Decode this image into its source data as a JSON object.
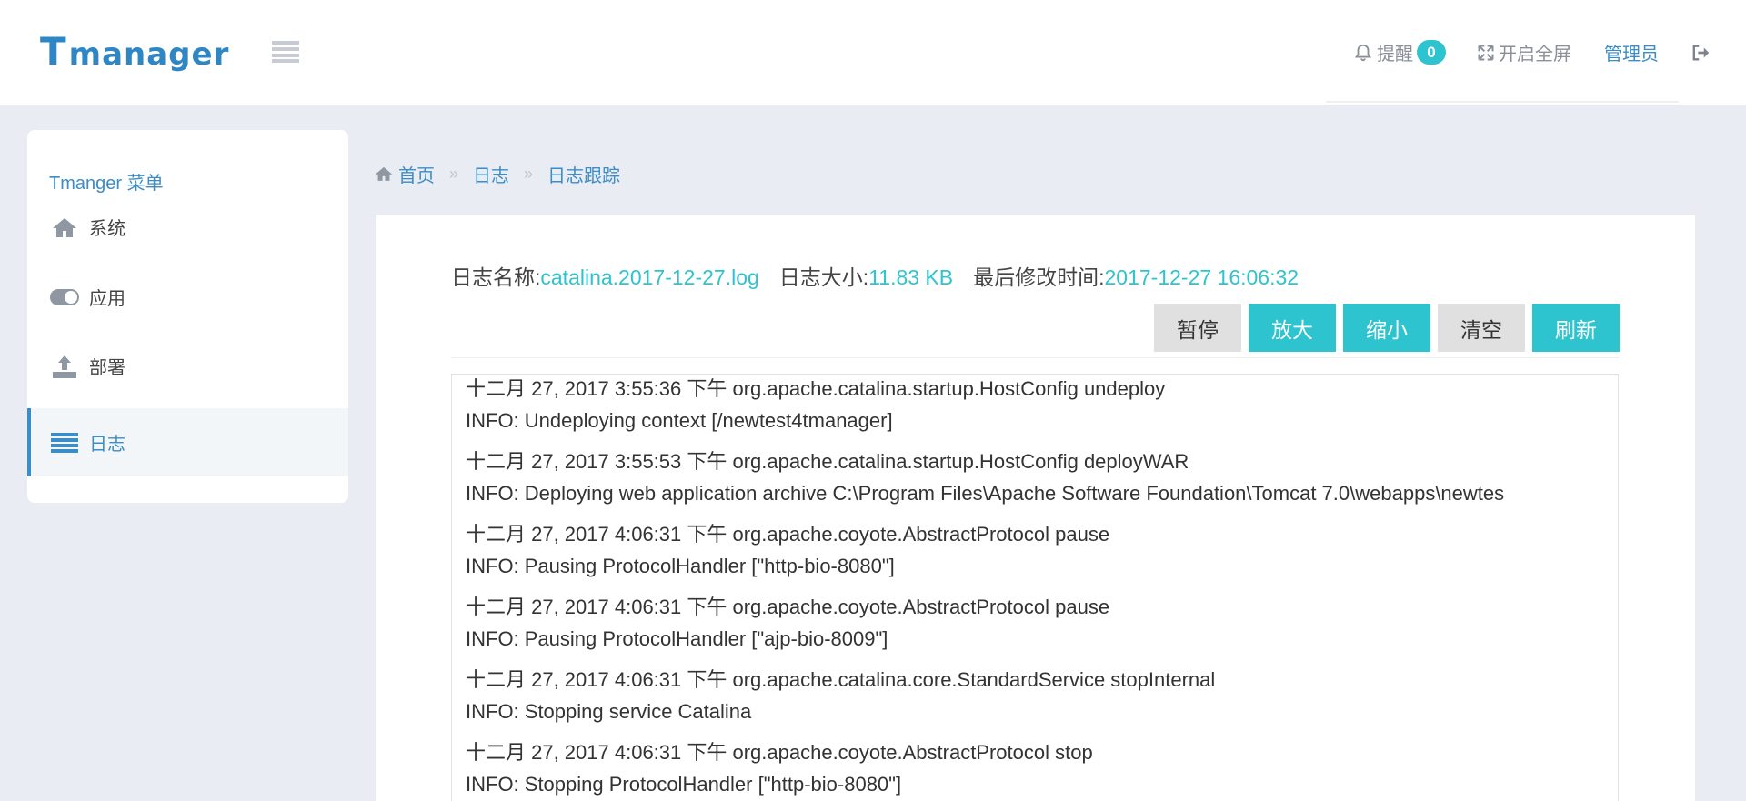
{
  "header": {
    "logo_big": "T",
    "logo_rest": "manager",
    "remind_label": "提醒",
    "remind_count": "0",
    "fullscreen_label": "开启全屏",
    "admin_label": "管理员"
  },
  "sidebar": {
    "title": "Tmanger 菜单",
    "items": [
      {
        "label": "系统",
        "icon": "home-icon"
      },
      {
        "label": "应用",
        "icon": "toggle-icon"
      },
      {
        "label": "部署",
        "icon": "upload-icon"
      },
      {
        "label": "日志",
        "icon": "list-icon"
      }
    ]
  },
  "breadcrumb": {
    "items": [
      "首页",
      "日志",
      "日志跟踪"
    ],
    "separator": "»"
  },
  "log": {
    "name_label": "日志名称:",
    "name_value": "catalina.2017-12-27.log",
    "size_label": "日志大小:",
    "size_value": "11.83 KB",
    "modified_label": "最后修改时间:",
    "modified_value": "2017-12-27 16:06:32",
    "buttons": {
      "pause": "暂停",
      "zoom_in": "放大",
      "zoom_out": "缩小",
      "clear": "清空",
      "refresh": "刷新"
    },
    "lines": [
      "十二月 27, 2017 3:55:36 下午 org.apache.catalina.startup.HostConfig undeploy",
      "INFO: Undeploying context [/newtest4tmanager]",
      "十二月 27, 2017 3:55:53 下午 org.apache.catalina.startup.HostConfig deployWAR",
      "INFO: Deploying web application archive C:\\Program Files\\Apache Software Foundation\\Tomcat 7.0\\webapps\\newtes",
      "十二月 27, 2017 4:06:31 下午 org.apache.coyote.AbstractProtocol pause",
      "INFO: Pausing ProtocolHandler [\"http-bio-8080\"]",
      "十二月 27, 2017 4:06:31 下午 org.apache.coyote.AbstractProtocol pause",
      "INFO: Pausing ProtocolHandler [\"ajp-bio-8009\"]",
      "十二月 27, 2017 4:06:31 下午 org.apache.catalina.core.StandardService stopInternal",
      "INFO: Stopping service Catalina",
      "十二月 27, 2017 4:06:31 下午 org.apache.coyote.AbstractProtocol stop",
      "INFO: Stopping ProtocolHandler [\"http-bio-8080\"]"
    ]
  },
  "colors": {
    "accent": "#3c8dc6",
    "cyan": "#2ec4cf",
    "background": "#e9ecf3"
  }
}
